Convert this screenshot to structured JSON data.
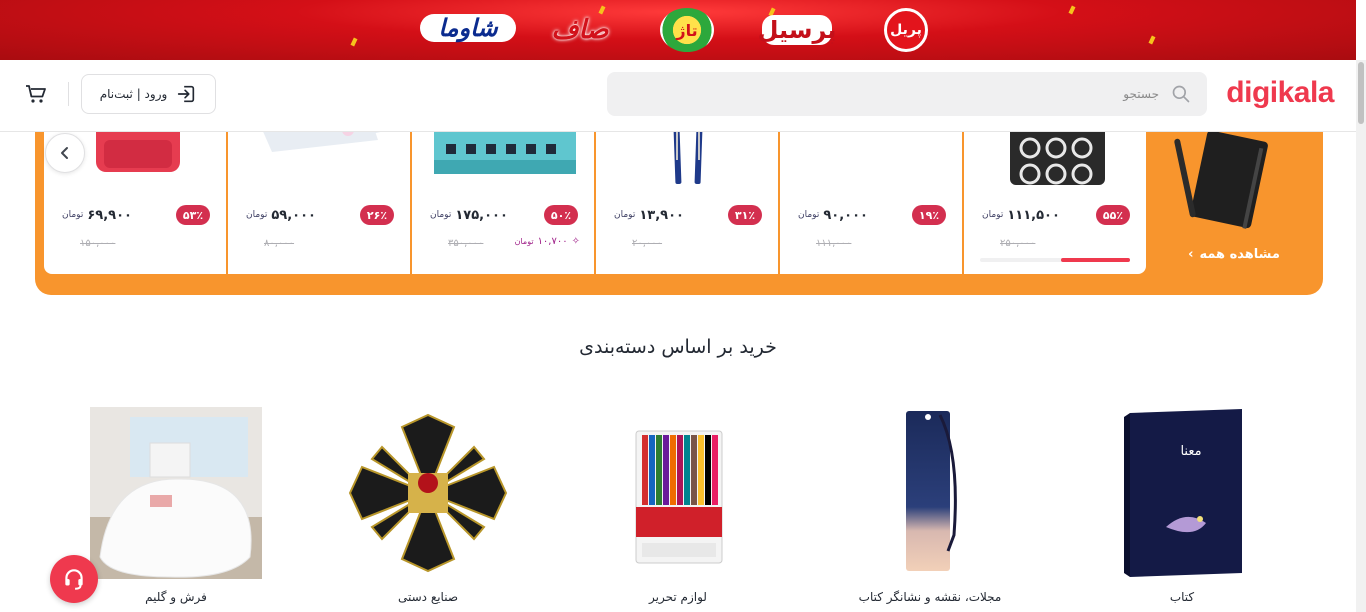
{
  "promo": {
    "brands": [
      "شاوما",
      "صاف",
      "تاژ",
      "پرسیل",
      "پریل"
    ],
    "background_color": "#d40f17"
  },
  "header": {
    "logo": "digikala",
    "search_placeholder": "جستجو",
    "login_label": "ورود | ثبت‌نام",
    "logo_color": "#ef394e"
  },
  "offers": {
    "panel_color": "#f8952d",
    "see_all": "مشاهده همه",
    "currency": "تومان",
    "items": [
      {
        "discount": "۵۵٪",
        "price": "۱۱۱,۵۰۰",
        "old_price": "۲۵۰,۰۰۰",
        "sold_fraction": 0.46,
        "image": "notebook-pattern"
      },
      {
        "discount": "۱۹٪",
        "price": "۹۰,۰۰۰",
        "old_price": "۱۱۱,۰۰۰",
        "image": "cable"
      },
      {
        "discount": "۳۱٪",
        "price": "۱۳,۹۰۰",
        "old_price": "۲۰,۰۰۰",
        "image": "pens"
      },
      {
        "discount": "۵۰٪",
        "price": "۱۷۵,۰۰۰",
        "old_price": "۳۵۰,۰۰۰",
        "bonus": "۱۰,۷۰۰",
        "image": "box"
      },
      {
        "discount": "۲۶٪",
        "price": "۵۹,۰۰۰",
        "old_price": "۸۰,۰۰۰",
        "image": "stickers"
      },
      {
        "discount": "۵۳٪",
        "price": "۶۹,۹۰۰",
        "old_price": "۱۵۰,۰۰۰",
        "image": "red-bag"
      }
    ]
  },
  "categories": {
    "title": "خرید بر اساس دسته‌بندی",
    "items": [
      {
        "label": "کتاب",
        "image": "book"
      },
      {
        "label": "مجلات، نقشه و نشانگر کتاب",
        "image": "bookmark"
      },
      {
        "label": "لوازم تحریر",
        "image": "markers"
      },
      {
        "label": "صنایع دستی",
        "image": "handicraft-box"
      },
      {
        "label": "فرش و گلیم",
        "image": "rug"
      }
    ]
  }
}
